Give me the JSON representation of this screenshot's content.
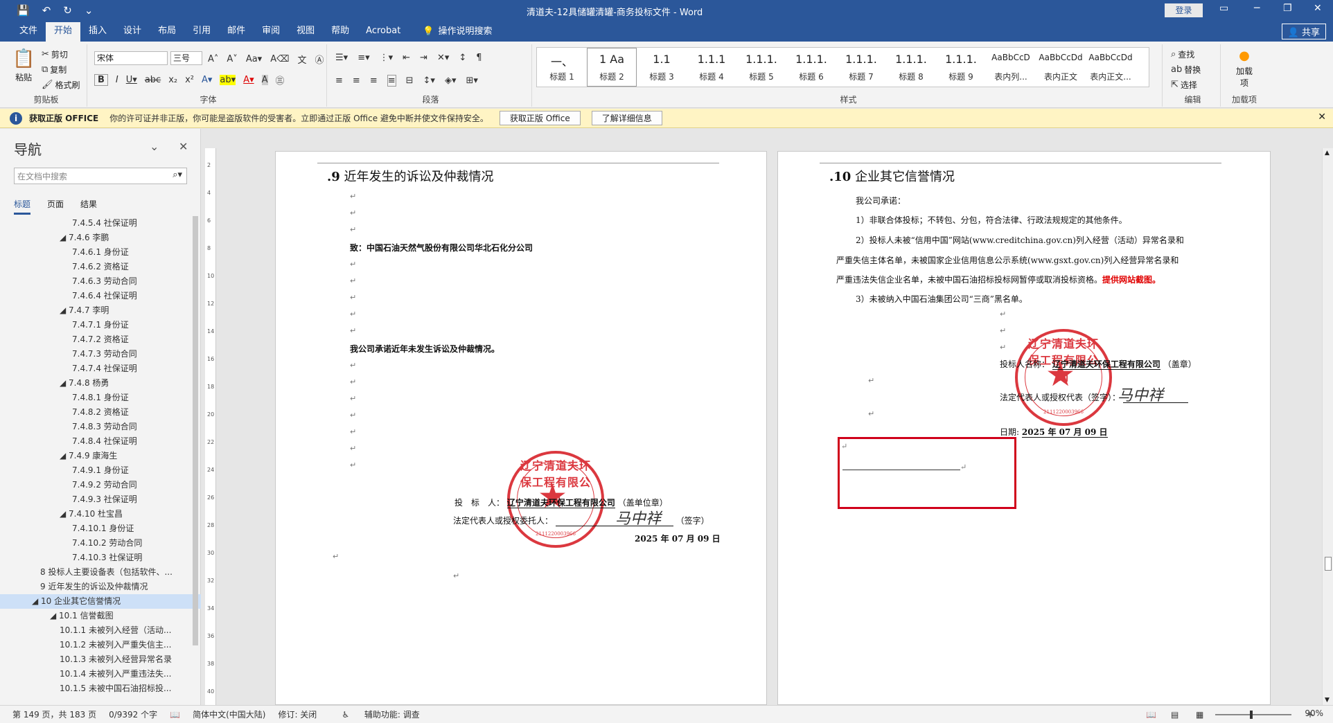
{
  "titlebar": {
    "title": "清道夫-12具储罐清罐-商务投标文件 - Word",
    "login": "登录",
    "qat": [
      "💾",
      "↶",
      "↻",
      "⌄"
    ]
  },
  "tabs": [
    "文件",
    "开始",
    "插入",
    "设计",
    "布局",
    "引用",
    "邮件",
    "审阅",
    "视图",
    "帮助",
    "Acrobat"
  ],
  "tell_me": "操作说明搜索",
  "share": "共享",
  "ribbon": {
    "clipboard": {
      "label": "剪贴板",
      "paste": "粘贴",
      "cut": "剪切",
      "copy": "复制",
      "format_painter": "格式刷"
    },
    "font": {
      "label": "字体",
      "name": "宋体",
      "size": "三号"
    },
    "paragraph": {
      "label": "段落"
    },
    "styles": {
      "label": "样式",
      "items": [
        {
          "preview": "一、",
          "name": "标题 1"
        },
        {
          "preview": "1 Aa",
          "name": "标题 2"
        },
        {
          "preview": "1.1 ",
          "name": "标题 3"
        },
        {
          "preview": "1.1.1",
          "name": "标题 4"
        },
        {
          "preview": "1.1.1.",
          "name": "标题 5"
        },
        {
          "preview": "1.1.1.",
          "name": "标题 6"
        },
        {
          "preview": "1.1.1.",
          "name": "标题 7"
        },
        {
          "preview": "1.1.1.",
          "name": "标题 8"
        },
        {
          "preview": "1.1.1.",
          "name": "标题 9"
        },
        {
          "preview": "AaBbCcD",
          "name": "表内列..."
        },
        {
          "preview": "AaBbCcDd",
          "name": "表内正文"
        },
        {
          "preview": "AaBbCcDd",
          "name": "表内正文..."
        }
      ]
    },
    "editing": {
      "label": "编辑",
      "find": "查找",
      "replace": "替换",
      "select": "选择"
    },
    "addins": {
      "label": "加载项",
      "btn": "加载项"
    }
  },
  "msgbar": {
    "title": "获取正版 OFFICE",
    "text": "你的许可证并非正版，你可能是盗版软件的受害者。立即通过正版 Office 避免中断并使文件保持安全。",
    "btn1": "获取正版 Office",
    "btn2": "了解详细信息"
  },
  "nav": {
    "title": "导航",
    "search_placeholder": "在文档中搜索",
    "tabs": [
      "标题",
      "页面",
      "结果"
    ],
    "items": [
      {
        "t": "7.4.5.4 社保证明",
        "l": 4
      },
      {
        "t": "◢ 7.4.6 李鹏",
        "l": 3
      },
      {
        "t": "7.4.6.1 身份证",
        "l": 4
      },
      {
        "t": "7.4.6.2 资格证",
        "l": 4
      },
      {
        "t": "7.4.6.3 劳动合同",
        "l": 4
      },
      {
        "t": "7.4.6.4 社保证明",
        "l": 4
      },
      {
        "t": "◢ 7.4.7 李明",
        "l": 3
      },
      {
        "t": "7.4.7.1 身份证",
        "l": 4
      },
      {
        "t": "7.4.7.2 资格证",
        "l": 4
      },
      {
        "t": "7.4.7.3 劳动合同",
        "l": 4
      },
      {
        "t": "7.4.7.4 社保证明",
        "l": 4
      },
      {
        "t": "◢ 7.4.8 杨勇",
        "l": 3
      },
      {
        "t": "7.4.8.1 身份证",
        "l": 4
      },
      {
        "t": "7.4.8.2 资格证",
        "l": 4
      },
      {
        "t": "7.4.8.3 劳动合同",
        "l": 4
      },
      {
        "t": "7.4.8.4 社保证明",
        "l": 4
      },
      {
        "t": "◢ 7.4.9 康海生",
        "l": 3
      },
      {
        "t": "7.4.9.1 身份证",
        "l": 4
      },
      {
        "t": "7.4.9.2 劳动合同",
        "l": 4
      },
      {
        "t": "7.4.9.3 社保证明",
        "l": 4
      },
      {
        "t": "◢ 7.4.10 杜宝昌",
        "l": 3
      },
      {
        "t": "7.4.10.1 身份证",
        "l": 4
      },
      {
        "t": "7.4.10.2 劳动合同",
        "l": 4
      },
      {
        "t": "7.4.10.3 社保证明",
        "l": 4
      },
      {
        "t": "8 投标人主要设备表（包括软件、...",
        "l": 1
      },
      {
        "t": "9 近年发生的诉讼及仲裁情况",
        "l": 1
      },
      {
        "t": "◢ 10 企业其它信誉情况",
        "l": 0,
        "sel": true
      },
      {
        "t": "◢ 10.1 信誉截图",
        "l": 2
      },
      {
        "t": "10.1.1 未被列入经营（活动...",
        "l": 3
      },
      {
        "t": "10.1.2 未被列入严重失信主...",
        "l": 3
      },
      {
        "t": "10.1.3 未被列入经营异常名录",
        "l": 3
      },
      {
        "t": "10.1.4 未被列入严重违法失...",
        "l": 3
      },
      {
        "t": "10.1.5 未被中国石油招标投...",
        "l": 3
      }
    ]
  },
  "page1": {
    "heading_num": ".9",
    "heading": "近年发生的诉讼及仲裁情况",
    "to": "致：中国石油天然气股份有限公司华北石化分公司",
    "commit": "我公司承诺近年未发生诉讼及仲裁情况。",
    "bidder_label": "投　标　人：",
    "bidder": "辽宁清道夫环保工程有限公司",
    "bidder_suffix": "（盖单位章）",
    "rep_label": "法定代表人或授权委托人：",
    "rep_suffix": "（签字）",
    "date": "2025 年 07 月 09 日",
    "signature": "马中祥"
  },
  "page2": {
    "heading_num": ".10",
    "heading": "企业其它信誉情况",
    "intro": "我公司承诺：",
    "l1": "1）非联合体投标；不转包、分包，符合法律、行政法规规定的其他条件。",
    "l2a": "2）投标人未被“信用中国”网站(www.creditchina.gov.cn)列入经营（活动）异常名录和",
    "l2b": "严重失信主体名单，未被国家企业信用信息公示系统(www.gsxt.gov.cn)列入经营异常名录和",
    "l2c": "严重违法失信企业名单，未被中国石油招标投标网暂停或取消投标资格。",
    "l2c_red": "提供网站截图。",
    "l3": "3）未被纳入中国石油集团公司“三商”黑名单。",
    "bidder_label": "投标人名称：",
    "bidder": "辽宁清道夫环保工程有限公司",
    "bidder_suffix": "（盖章）",
    "rep_label": "法定代表人或授权代表（签字）：",
    "date_label": "日期:",
    "date": "2025 年 07 月 09 日",
    "signature": "马中祥"
  },
  "seal": {
    "text": "辽宁清道夫环保工程有限公司",
    "number": "2111220003966"
  },
  "ruler_h": [
    "6",
    "4",
    "2",
    "",
    "2",
    "4",
    "6",
    "8",
    "10",
    "12",
    "14",
    "16",
    "18",
    "20",
    "22",
    "24",
    "26",
    "28",
    "30",
    "32",
    "34",
    "36",
    "38",
    "40",
    "42",
    "44",
    "46",
    "48"
  ],
  "ruler_v": [
    "2",
    "4",
    "6",
    "8",
    "10",
    "12",
    "14",
    "16",
    "18",
    "20",
    "22",
    "24",
    "26",
    "28",
    "30",
    "32",
    "34",
    "36",
    "38",
    "40"
  ],
  "status": {
    "page": "第 149 页，共 183 页",
    "words": "0/9392 个字",
    "lang": "简体中文(中国大陆)",
    "track": "修订: 关闭",
    "access": "辅助功能: 调查",
    "zoom": "90%"
  }
}
